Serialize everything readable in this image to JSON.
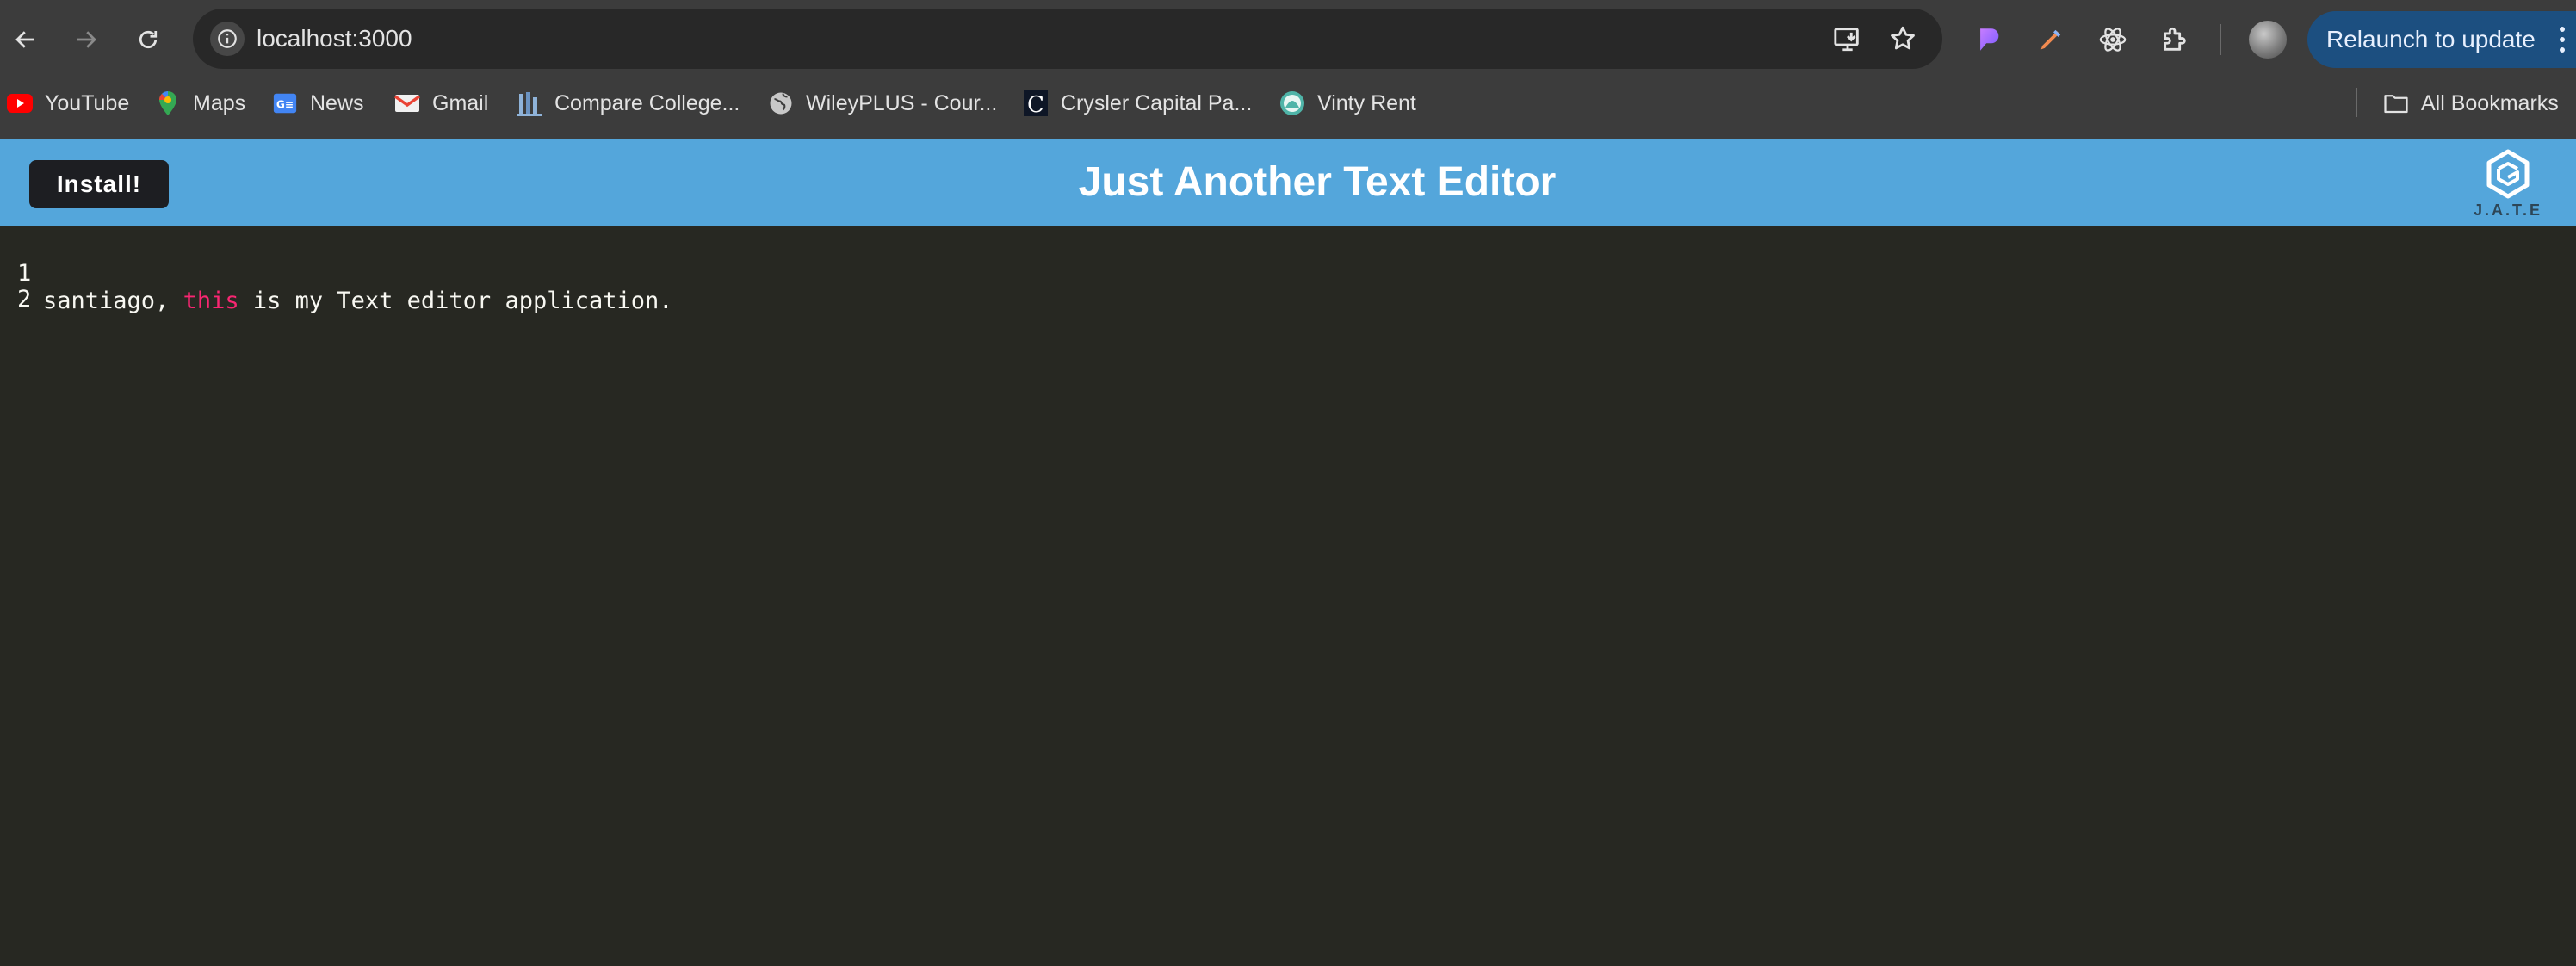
{
  "browser": {
    "url": "localhost:3000",
    "relaunch_label": "Relaunch to update",
    "bookmarks": [
      {
        "label": "YouTube",
        "icon": "youtube-icon"
      },
      {
        "label": "Maps",
        "icon": "maps-icon"
      },
      {
        "label": "News",
        "icon": "news-icon"
      },
      {
        "label": "Gmail",
        "icon": "gmail-icon"
      },
      {
        "label": "Compare College...",
        "icon": "compare-college-icon"
      },
      {
        "label": "WileyPLUS - Cour...",
        "icon": "globe-icon"
      },
      {
        "label": "Crysler Capital Pa...",
        "icon": "crysler-icon"
      },
      {
        "label": "Vinty Rent",
        "icon": "vinty-icon"
      }
    ],
    "all_bookmarks_label": "All Bookmarks"
  },
  "app": {
    "install_label": "Install!",
    "title": "Just Another Text Editor",
    "logo_text": "J.A.T.E"
  },
  "editor": {
    "lines": [
      {
        "number": "1",
        "before": "santiago, ",
        "keyword": "this",
        "after": " is my Text editor application."
      },
      {
        "number": "2",
        "before": "",
        "keyword": "",
        "after": ""
      }
    ]
  },
  "colors": {
    "header": "#54a6db",
    "editor_bg": "#272822",
    "keyword": "#f92672",
    "install_bg": "#1d1e22"
  }
}
